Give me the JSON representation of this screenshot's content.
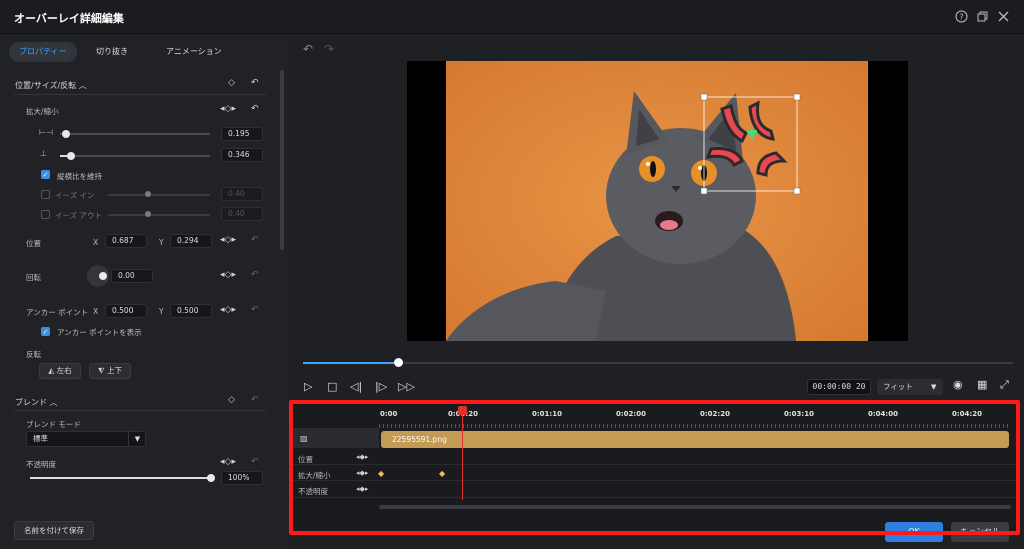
{
  "window": {
    "title": "オーバーレイ詳細編集"
  },
  "tabs": [
    {
      "label": "プロパティー"
    },
    {
      "label": "切り抜き"
    },
    {
      "label": "アニメーション"
    }
  ],
  "properties": {
    "position_section": "位置/サイズ/反転",
    "scale_label": "拡大/縮小",
    "width_value": "0.195",
    "height_value": "0.346",
    "keep_ratio_label": "縦横比を維持",
    "ease_in_label": "イーズ イン",
    "ease_in_value": "0.40",
    "ease_out_label": "イーズ アウト",
    "ease_out_value": "0.40",
    "position_label": "位置",
    "x_label": "X",
    "y_label": "Y",
    "pos_x": "0.687",
    "pos_y": "0.294",
    "rotate_label": "回転",
    "rotate_value": "0.00",
    "anchor_label": "アンカー ポイント",
    "anchor_x": "0.500",
    "anchor_y": "0.500",
    "show_anchor_label": "アンカー ポイントを表示",
    "flip_label": "反転",
    "flip_h_label": "左右",
    "flip_v_label": "上下"
  },
  "blend": {
    "section": "ブレンド",
    "mode_label": "ブレンド モード",
    "mode_value": "標準",
    "opacity_label": "不透明度",
    "opacity_value": "100%"
  },
  "save_button": "名前を付けて保存",
  "preview": {
    "timecode": "00:00:00 20",
    "fit": "フィット",
    "progress": 0.134
  },
  "timeline": {
    "ruler": [
      "0:00",
      "0:00:20",
      "0:01:10",
      "0:02:00",
      "0:02:20",
      "0:03:10",
      "0:04:00",
      "0:04:20"
    ],
    "clip_name": "22595591.png",
    "tracks": [
      "位置",
      "拡大/縮小",
      "不透明度"
    ]
  },
  "footer": {
    "ok": "OK",
    "cancel": "キャンセル"
  },
  "colors": {
    "accent": "#3ea6ff",
    "highlight": "#ff1a1a",
    "clip": "#c39b55",
    "playhead": "#e1322e"
  }
}
